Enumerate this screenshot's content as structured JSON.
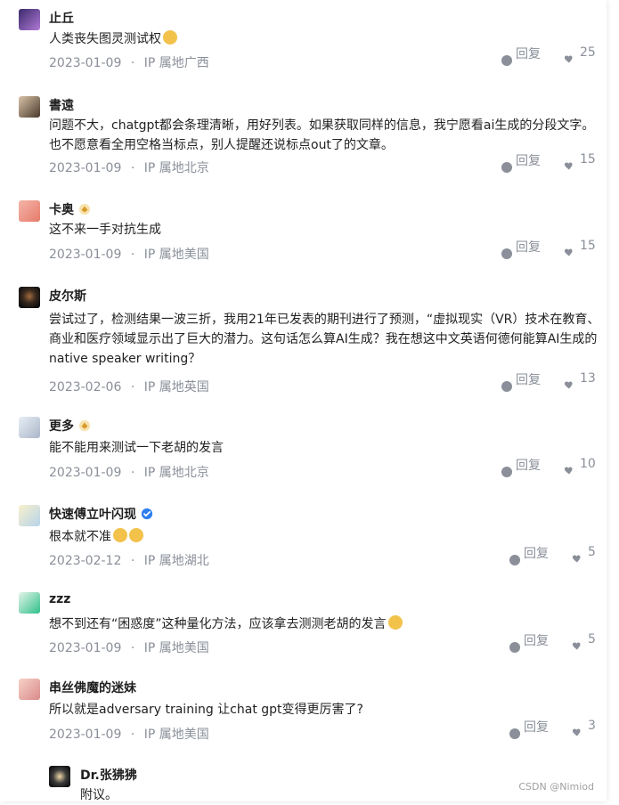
{
  "colors": {
    "meta_gray": "#8a8f99",
    "text": "#222222"
  },
  "comments": [
    {
      "name": "止丘",
      "content": "人类丧失图灵测试权",
      "emoji_count": 1,
      "date": "2023-01-09",
      "sep": "·",
      "location": "IP 属地广西",
      "reply": "回复",
      "likes": "25",
      "badge": null
    },
    {
      "name": "書遠",
      "content": "问题不大，chatgpt都会条理清晰，用好列表。如果获取同样的信息，我宁愿看ai生成的分段文字。也不愿意看全用空格当标点，别人提醒还说标点out了的文章。",
      "date": "2023-01-09",
      "sep": "·",
      "location": "IP 属地北京",
      "reply": "回复",
      "likes": "15",
      "badge": null
    },
    {
      "name": "卡奥",
      "content": "这不来一手对抗生成",
      "date": "2023-01-09",
      "sep": "·",
      "location": "IP 属地美国",
      "reply": "回复",
      "likes": "15",
      "badge": "level-badge-icon"
    },
    {
      "name": "皮尔斯",
      "content": "尝试过了，检测结果一波三折，我用21年已发表的期刊进行了预测，“虚拟现实（VR）技术在教育、商业和医疗领域显示出了巨大的潜力。这句话怎么算AI生成？我在想这中文英语何德何能算AI生成的native speaker writing？",
      "date": "2023-02-06",
      "sep": "·",
      "location": "IP 属地英国",
      "reply": "回复",
      "likes": "13",
      "badge": null
    },
    {
      "name": "更多",
      "content": "能不能用来测试一下老胡的发言",
      "date": "2023-01-09",
      "sep": "·",
      "location": "IP 属地北京",
      "reply": "回复",
      "likes": "10",
      "badge": "level-badge-icon"
    },
    {
      "name": "快速傅立叶闪现",
      "content": "根本就不准",
      "emoji_count": 2,
      "date": "2023-02-12",
      "sep": "·",
      "location": "IP 属地湖北",
      "reply": "回复",
      "likes": "5",
      "badge": "verified-icon"
    },
    {
      "name": "zzz",
      "content": "想不到还有“困惑度”这种量化方法，应该拿去测测老胡的发言",
      "emoji_count": 1,
      "date": "2023-01-09",
      "sep": "·",
      "location": "IP 属地美国",
      "reply": "回复",
      "likes": "5",
      "badge": null
    },
    {
      "name": "串丝佛魔的迷妹",
      "content": "所以就是adversary training 让chat gpt变得更厉害了?",
      "date": "2023-01-09",
      "sep": "·",
      "location": "IP 属地美国",
      "reply": "回复",
      "likes": "3",
      "badge": null
    }
  ],
  "subcomment": {
    "name": "Dr.张狒狒",
    "content": "附议。"
  },
  "more_label": "···",
  "watermark": "CSDN @Nimiod"
}
